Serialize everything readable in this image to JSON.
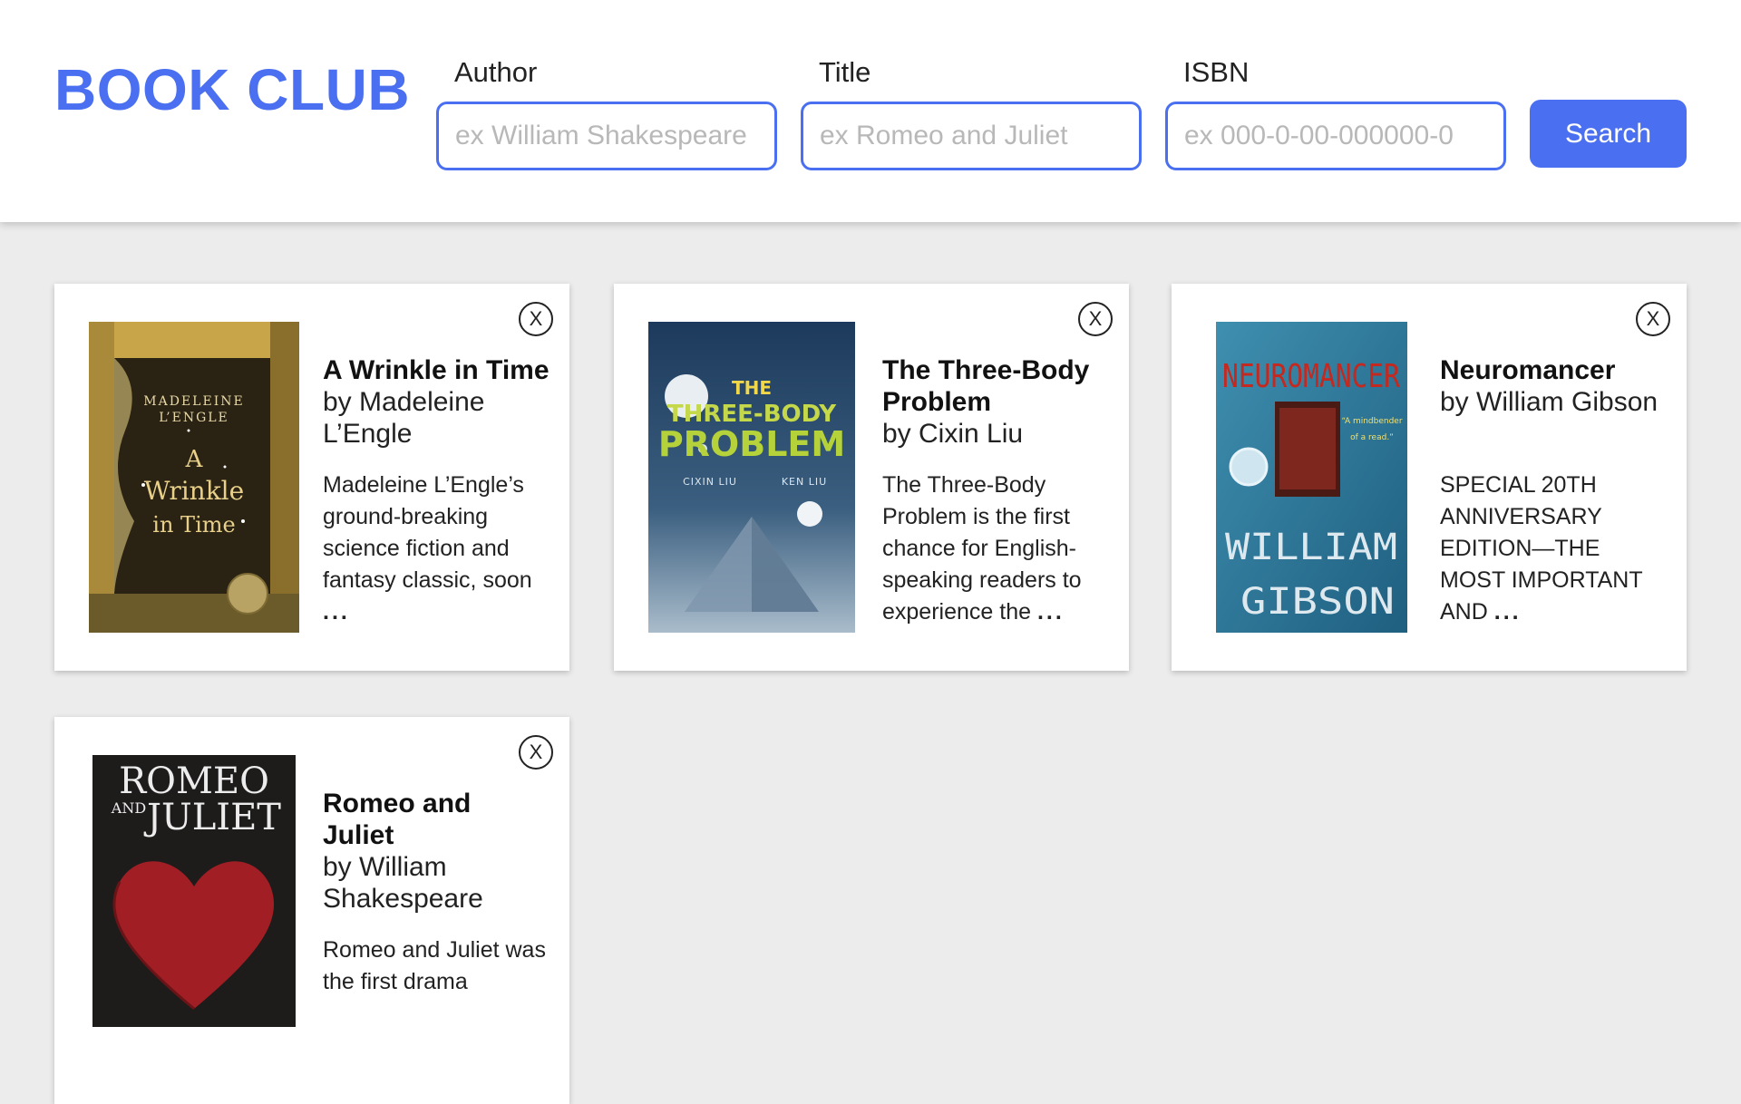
{
  "app": {
    "title": "BOOK CLUB"
  },
  "search": {
    "author_label": "Author",
    "author_placeholder": "ex William Shakespeare",
    "title_label": "Title",
    "title_placeholder": "ex Romeo and Juliet",
    "isbn_label": "ISBN",
    "isbn_placeholder": "ex 000-0-00-000000-0",
    "button_label": "Search"
  },
  "colors": {
    "accent": "#4a6ff0",
    "background": "#ececec"
  },
  "books": [
    {
      "title": "A Wrinkle in Time",
      "author": "by Madeleine L’Engle",
      "description": "Madeleine L’Engle’s ground-breaking science fiction and fantasy classic, soon",
      "ellipsis": "...",
      "close_label": "X",
      "cover": {
        "author_line1": "MADELEINE",
        "author_line2": "L’ENGLE",
        "title_line1": "A",
        "title_line2": "Wrinkle",
        "title_line3": "in Time"
      }
    },
    {
      "title": "The Three-Body Problem",
      "author": "by Cixin Liu",
      "description": "The Three-Body Problem is the first chance for English-speaking readers to experience the",
      "ellipsis": "...",
      "close_label": "X",
      "cover": {
        "title_line1": "THE",
        "title_line2": "THREE-BODY",
        "title_line3": "PROBLEM",
        "author": "CIXIN LIU",
        "translator": "KEN LIU"
      }
    },
    {
      "title": "Neuromancer",
      "author": "by William Gibson",
      "description": "SPECIAL 20TH ANNIVERSARY EDITION—THE MOST IMPORTANT AND",
      "ellipsis": "...",
      "close_label": "X",
      "cover": {
        "title": "NEUROMANCER",
        "author_line1": "WILLIAM",
        "author_line2": "GIBSON",
        "quote": "\"A mindbender of a read.\" —Village Voice"
      }
    },
    {
      "title": "Romeo and Juliet",
      "author": "by William Shakespeare",
      "description": "Romeo and Juliet was the first drama",
      "ellipsis": "",
      "close_label": "X",
      "cover": {
        "title_line1": "ROMEO",
        "title_and": "AND",
        "title_line2": "JULIET"
      }
    }
  ]
}
